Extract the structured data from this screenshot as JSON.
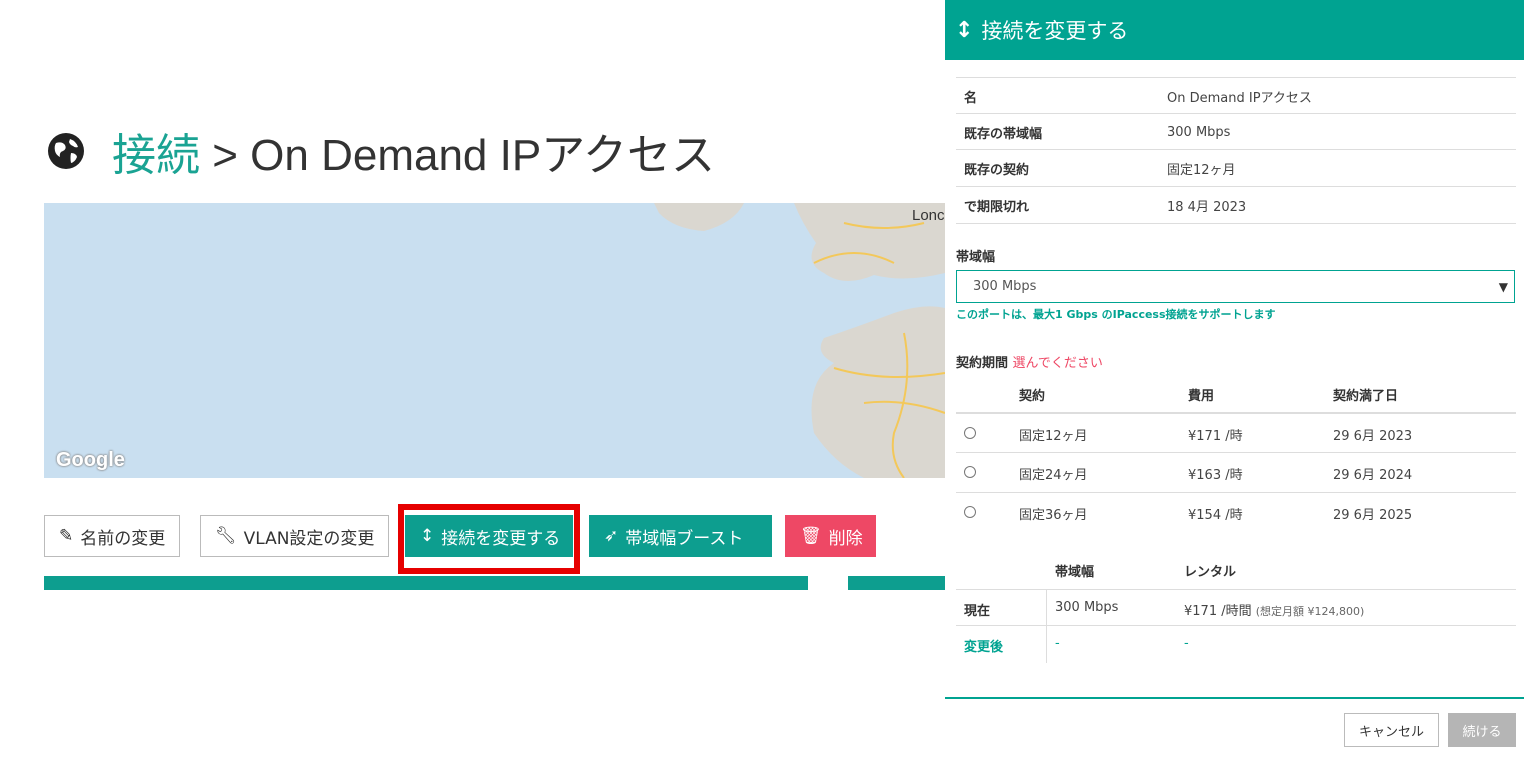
{
  "page": {
    "breadcrumb_link": "接続",
    "breadcrumb_sep": " > ",
    "breadcrumb_current": "On Demand IPアクセス"
  },
  "map": {
    "attribution": "Google",
    "city_label": "Lonc"
  },
  "actions": {
    "rename": "名前の変更",
    "vlan": "VLAN設定の変更",
    "change": "接続を変更する",
    "boost": "帯域幅ブースト",
    "delete": "削除"
  },
  "modal": {
    "title": "接続を変更する",
    "info": [
      {
        "key": "名",
        "value": "On Demand IPアクセス"
      },
      {
        "key": "既存の帯域幅",
        "value": "300 Mbps"
      },
      {
        "key": "既存の契約",
        "value": "固定12ヶ月"
      },
      {
        "key": "で期限切れ",
        "value": "18 4月 2023"
      }
    ],
    "bandwidth_label": "帯域幅",
    "bandwidth_selected": "300 Mbps",
    "bandwidth_hint": "このポートは、最大1 Gbps のIPaccess接続をサポートします",
    "term_label": "契約期間",
    "term_prompt": "選んでください",
    "contract_headers": {
      "contract": "契約",
      "cost": "費用",
      "end": "契約満了日"
    },
    "contracts": [
      {
        "contract": "固定12ヶ月",
        "cost": "¥171 /時",
        "end": "29 6月 2023"
      },
      {
        "contract": "固定24ヶ月",
        "cost": "¥163 /時",
        "end": "29 6月 2024"
      },
      {
        "contract": "固定36ヶ月",
        "cost": "¥154 /時",
        "end": "29 6月 2025"
      }
    ],
    "summary_headers": {
      "bandwidth": "帯域幅",
      "rental": "レンタル"
    },
    "summary": [
      {
        "label": "現在",
        "bandwidth": "300 Mbps",
        "rental": "¥171 /時間",
        "note": "(想定月額 ¥124,800)"
      },
      {
        "label": "変更後",
        "bandwidth": "-",
        "rental": "-",
        "note": ""
      }
    ],
    "cancel": "キャンセル",
    "continue": "続ける"
  },
  "colors": {
    "teal": "#00a391",
    "red": "#ee4865",
    "highlight": "#e60000"
  }
}
